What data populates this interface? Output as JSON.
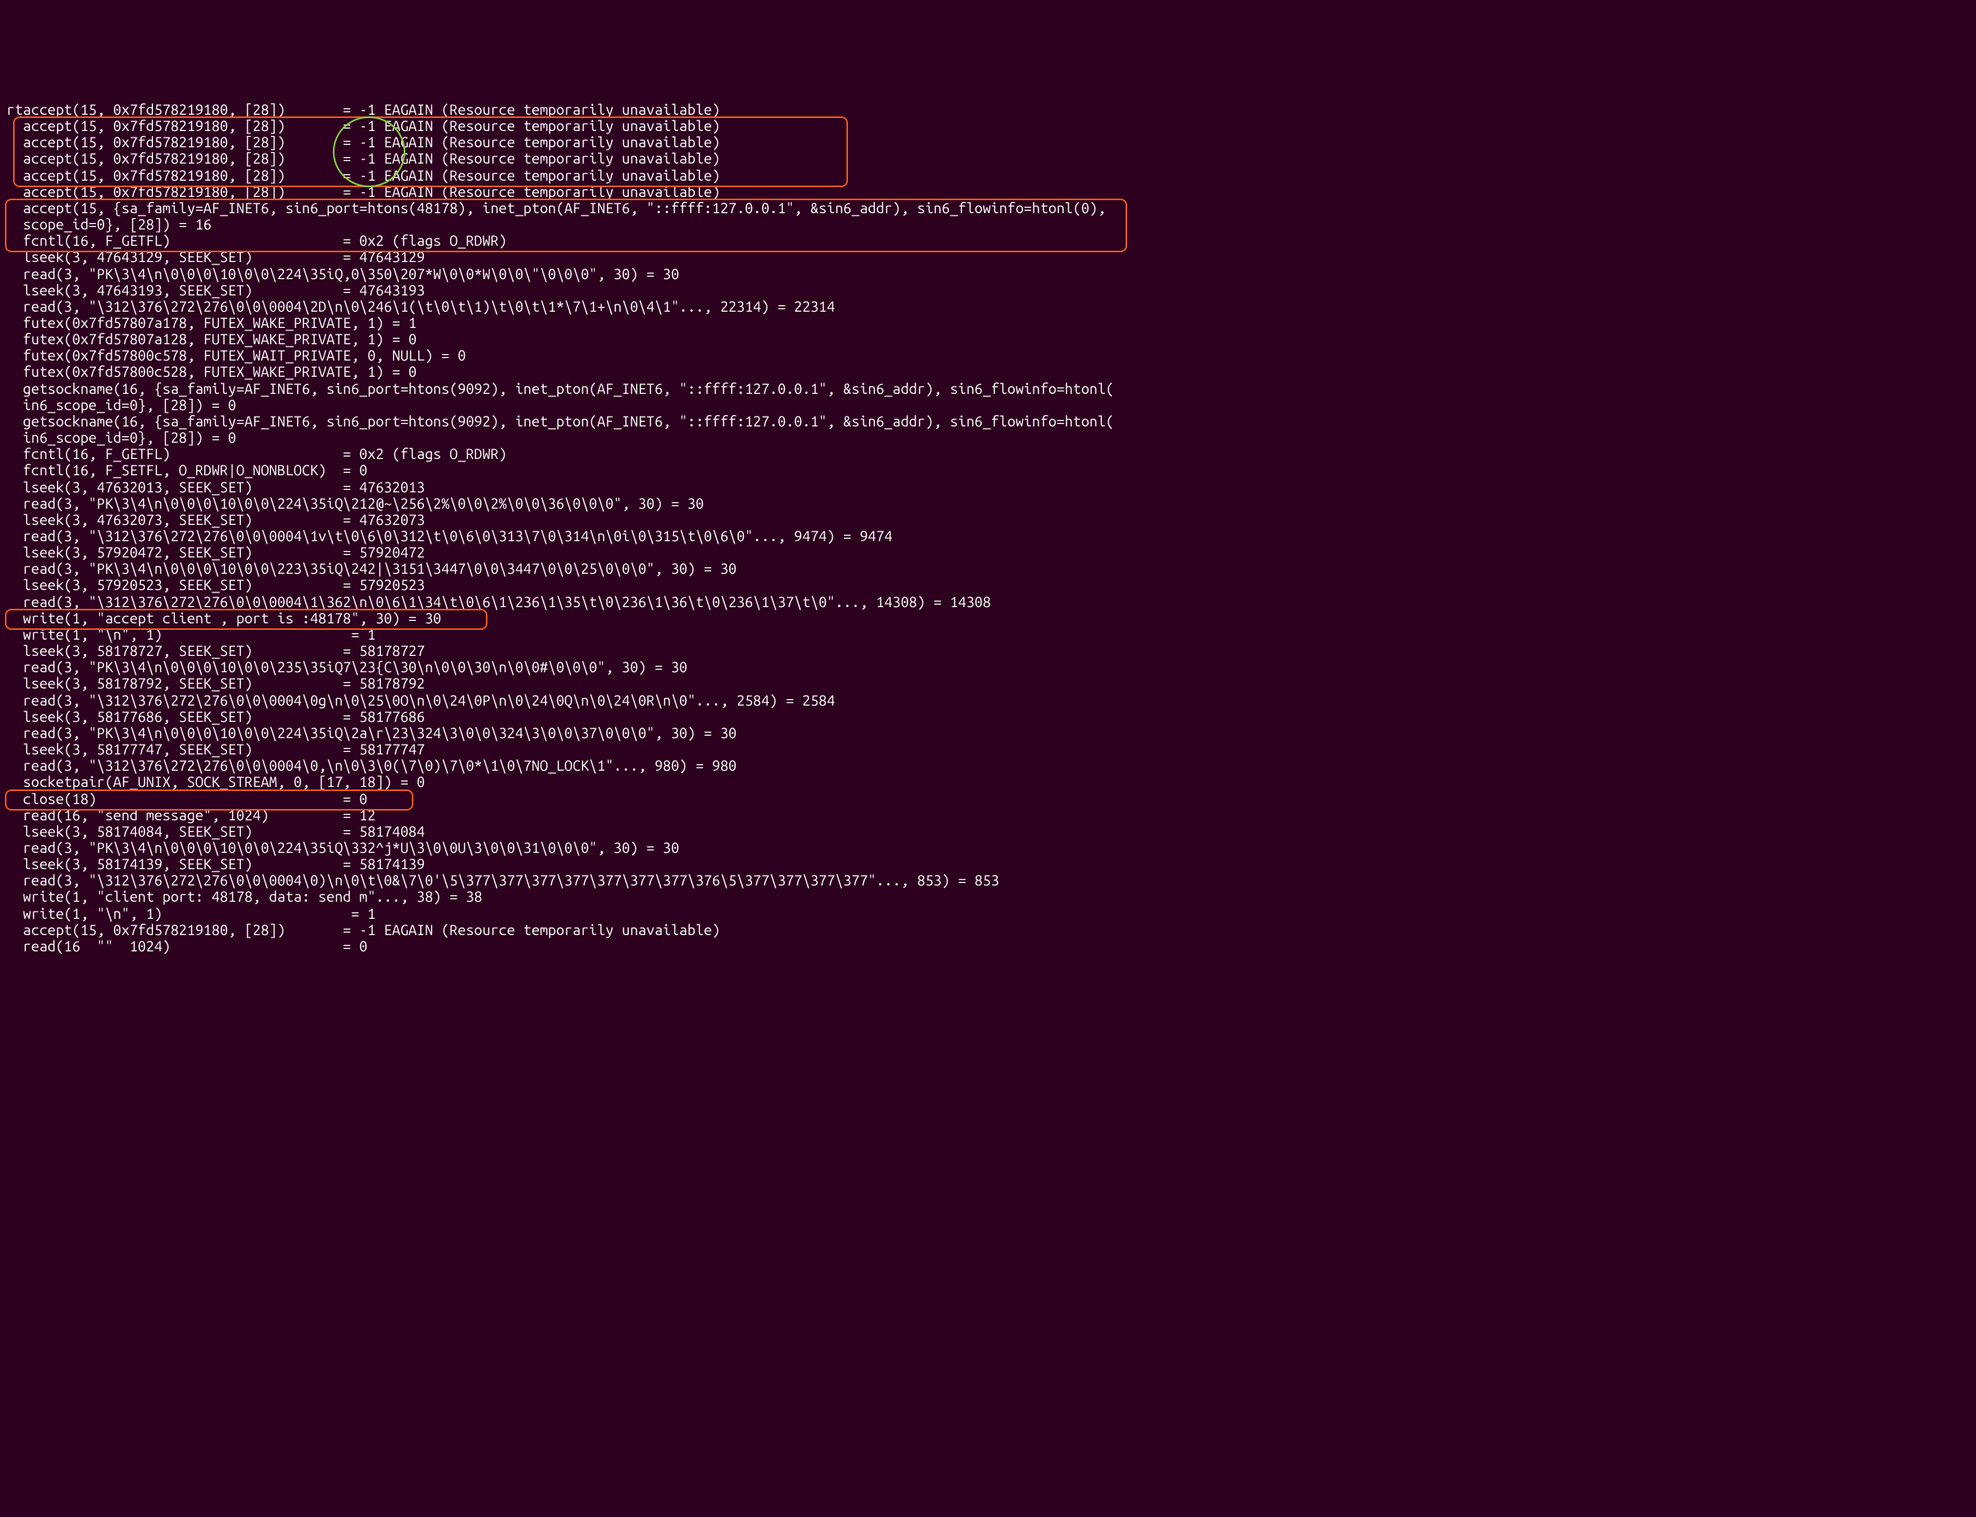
{
  "annotations": {
    "box1": {
      "top_line": 1,
      "height_lines": 4,
      "left_ch": 1,
      "width_ch": 101
    },
    "box2": {
      "top_line": 6,
      "height_lines": 3,
      "left_ch": 0,
      "width_ch": 136
    },
    "box3": {
      "top_line": 31,
      "height_lines": 1,
      "left_ch": 0,
      "width_ch": 58
    },
    "box4": {
      "top_line": 42,
      "height_lines": 1,
      "left_ch": 0,
      "width_ch": 49
    },
    "circle": {
      "top_line": 1,
      "height_lines": 4,
      "left_ch": 40,
      "width_ch": 8
    }
  },
  "lines": [
    "rtaccept(15, 0x7fd578219180, [28])       = -1 EAGAIN (Resource temporarily unavailable)",
    "  accept(15, 0x7fd578219180, [28])       = -1 EAGAIN (Resource temporarily unavailable)",
    "  accept(15, 0x7fd578219180, [28])       = -1 EAGAIN (Resource temporarily unavailable)",
    "  accept(15, 0x7fd578219180, [28])       = -1 EAGAIN (Resource temporarily unavailable)",
    "  accept(15, 0x7fd578219180, [28])       = -1 EAGAIN (Resource temporarily unavailable)",
    "  accept(15, 0x7fd578219180, [28])       = -1 EAGAIN (Resource temporarily unavailable)",
    "  accept(15, {sa_family=AF_INET6, sin6_port=htons(48178), inet_pton(AF_INET6, \"::ffff:127.0.0.1\", &sin6_addr), sin6_flowinfo=htonl(0),",
    "  scope_id=0}, [28]) = 16",
    "  fcntl(16, F_GETFL)                     = 0x2 (flags O_RDWR)",
    "  lseek(3, 47643129, SEEK_SET)           = 47643129",
    "  read(3, \"PK\\3\\4\\n\\0\\0\\0\\10\\0\\0\\224\\35iQ,0\\350\\207*W\\0\\0*W\\0\\0\\\"\\0\\0\\0\", 30) = 30",
    "  lseek(3, 47643193, SEEK_SET)           = 47643193",
    "  read(3, \"\\312\\376\\272\\276\\0\\0\\0004\\2D\\n\\0\\246\\1(\\t\\0\\t\\1)\\t\\0\\t\\1*\\7\\1+\\n\\0\\4\\1\"..., 22314) = 22314",
    "  futex(0x7fd57807a178, FUTEX_WAKE_PRIVATE, 1) = 1",
    "  futex(0x7fd57807a128, FUTEX_WAKE_PRIVATE, 1) = 0",
    "  futex(0x7fd57800c578, FUTEX_WAIT_PRIVATE, 0, NULL) = 0",
    "  futex(0x7fd57800c528, FUTEX_WAKE_PRIVATE, 1) = 0",
    "  getsockname(16, {sa_family=AF_INET6, sin6_port=htons(9092), inet_pton(AF_INET6, \"::ffff:127.0.0.1\", &sin6_addr), sin6_flowinfo=htonl(",
    "  in6_scope_id=0}, [28]) = 0",
    "  getsockname(16, {sa_family=AF_INET6, sin6_port=htons(9092), inet_pton(AF_INET6, \"::ffff:127.0.0.1\", &sin6_addr), sin6_flowinfo=htonl(",
    "  in6_scope_id=0}, [28]) = 0",
    "  fcntl(16, F_GETFL)                     = 0x2 (flags O_RDWR)",
    "  fcntl(16, F_SETFL, O_RDWR|O_NONBLOCK)  = 0",
    "  lseek(3, 47632013, SEEK_SET)           = 47632013",
    "  read(3, \"PK\\3\\4\\n\\0\\0\\0\\10\\0\\0\\224\\35iQ\\212@~\\256\\2%\\0\\0\\2%\\0\\0\\36\\0\\0\\0\", 30) = 30",
    "  lseek(3, 47632073, SEEK_SET)           = 47632073",
    "  read(3, \"\\312\\376\\272\\276\\0\\0\\0004\\1v\\t\\0\\6\\0\\312\\t\\0\\6\\0\\313\\7\\0\\314\\n\\0i\\0\\315\\t\\0\\6\\0\"..., 9474) = 9474",
    "  lseek(3, 57920472, SEEK_SET)           = 57920472",
    "  read(3, \"PK\\3\\4\\n\\0\\0\\0\\10\\0\\0\\223\\35iQ\\242|\\3151\\3447\\0\\0\\3447\\0\\0\\25\\0\\0\\0\", 30) = 30",
    "  lseek(3, 57920523, SEEK_SET)           = 57920523",
    "  read(3, \"\\312\\376\\272\\276\\0\\0\\0004\\1\\362\\n\\0\\6\\1\\34\\t\\0\\6\\1\\236\\1\\35\\t\\0\\236\\1\\36\\t\\0\\236\\1\\37\\t\\0\"..., 14308) = 14308",
    "  write(1, \"accept client , port is :48178\", 30) = 30",
    "  write(1, \"\\n\", 1)                       = 1",
    "  lseek(3, 58178727, SEEK_SET)           = 58178727",
    "  read(3, \"PK\\3\\4\\n\\0\\0\\0\\10\\0\\0\\235\\35iQ7\\23{C\\30\\n\\0\\0\\30\\n\\0\\0#\\0\\0\\0\", 30) = 30",
    "  lseek(3, 58178792, SEEK_SET)           = 58178792",
    "  read(3, \"\\312\\376\\272\\276\\0\\0\\0004\\0g\\n\\0\\25\\0O\\n\\0\\24\\0P\\n\\0\\24\\0Q\\n\\0\\24\\0R\\n\\0\"..., 2584) = 2584",
    "  lseek(3, 58177686, SEEK_SET)           = 58177686",
    "  read(3, \"PK\\3\\4\\n\\0\\0\\0\\10\\0\\0\\224\\35iQ\\2a\\r\\23\\324\\3\\0\\0\\324\\3\\0\\0\\37\\0\\0\\0\", 30) = 30",
    "  lseek(3, 58177747, SEEK_SET)           = 58177747",
    "  read(3, \"\\312\\376\\272\\276\\0\\0\\0004\\0,\\n\\0\\3\\0(\\7\\0)\\7\\0*\\1\\0\\7NO_LOCK\\1\"..., 980) = 980",
    "  socketpair(AF_UNIX, SOCK_STREAM, 0, [17, 18]) = 0",
    "  close(18)                              = 0",
    "  read(16, \"send message\", 1024)         = 12",
    "  lseek(3, 58174084, SEEK_SET)           = 58174084",
    "  read(3, \"PK\\3\\4\\n\\0\\0\\0\\10\\0\\0\\224\\35iQ\\332^j*U\\3\\0\\0U\\3\\0\\0\\31\\0\\0\\0\", 30) = 30",
    "  lseek(3, 58174139, SEEK_SET)           = 58174139",
    "  read(3, \"\\312\\376\\272\\276\\0\\0\\0004\\0)\\n\\0\\t\\0&\\7\\0'\\5\\377\\377\\377\\377\\377\\377\\377\\376\\5\\377\\377\\377\\377\"..., 853) = 853",
    "  write(1, \"client port: 48178, data: send m\"..., 38) = 38",
    "  write(1, \"\\n\", 1)                       = 1",
    "  accept(15, 0x7fd578219180, [28])       = -1 EAGAIN (Resource temporarily unavailable)",
    "  read(16  \"\"  1024)                     = 0"
  ]
}
